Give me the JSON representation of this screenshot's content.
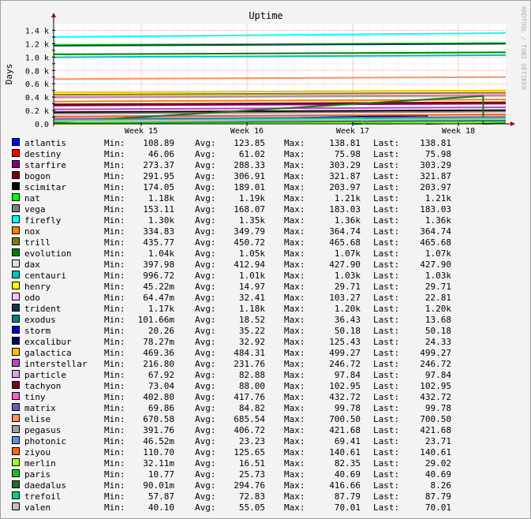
{
  "chart_data": {
    "type": "line",
    "title": "Uptime",
    "ylabel": "Days",
    "watermark": "RRDTOOL / TOBI OETIKER",
    "x_ticks": [
      "Week 15",
      "Week 16",
      "Week 17",
      "Week 18"
    ],
    "y_ticks": [
      "0.0",
      "0.2 k",
      "0.4 k",
      "0.6 k",
      "0.8 k",
      "1.0 k",
      "1.2 k",
      "1.4 k"
    ],
    "ylim": [
      0,
      1500
    ],
    "grid": true,
    "legend_placement": "bottom",
    "stat_labels": {
      "min": "Min:",
      "avg": "Avg:",
      "max": "Max:",
      "last": "Last:"
    },
    "series": [
      {
        "name": "atlantis",
        "color": "#0000ff",
        "min": "108.89",
        "avg": "123.85",
        "max": "138.81",
        "last": "138.81"
      },
      {
        "name": "destiny",
        "color": "#ff0000",
        "min": "46.06",
        "avg": "61.02",
        "max": "75.98",
        "last": "75.98"
      },
      {
        "name": "starfire",
        "color": "#800080",
        "min": "273.37",
        "avg": "288.33",
        "max": "303.29",
        "last": "303.29"
      },
      {
        "name": "bogon",
        "color": "#800000",
        "min": "291.95",
        "avg": "306.91",
        "max": "321.87",
        "last": "321.87"
      },
      {
        "name": "scimitar",
        "color": "#000000",
        "min": "174.05",
        "avg": "189.01",
        "max": "203.97",
        "last": "203.97"
      },
      {
        "name": "nat",
        "color": "#00ff00",
        "min": "1.18k",
        "avg": "1.19k",
        "max": "1.21k",
        "last": "1.21k"
      },
      {
        "name": "vega",
        "color": "#808080",
        "min": "153.11",
        "avg": "168.07",
        "max": "183.03",
        "last": "183.03"
      },
      {
        "name": "firefly",
        "color": "#00ffff",
        "min": "1.30k",
        "avg": "1.35k",
        "max": "1.36k",
        "last": "1.36k"
      },
      {
        "name": "nox",
        "color": "#ff8000",
        "min": "334.83",
        "avg": "349.79",
        "max": "364.74",
        "last": "364.74"
      },
      {
        "name": "trill",
        "color": "#808000",
        "min": "435.77",
        "avg": "450.72",
        "max": "465.68",
        "last": "465.68"
      },
      {
        "name": "evolution",
        "color": "#008000",
        "min": "1.04k",
        "avg": "1.05k",
        "max": "1.07k",
        "last": "1.07k"
      },
      {
        "name": "dax",
        "color": "#e0e0e0",
        "min": "397.98",
        "avg": "412.94",
        "max": "427.90",
        "last": "427.90"
      },
      {
        "name": "centauri",
        "color": "#00c0c0",
        "min": "996.72",
        "avg": "1.01k",
        "max": "1.03k",
        "last": "1.03k"
      },
      {
        "name": "henry",
        "color": "#ffff00",
        "min": "45.22m",
        "avg": "14.97",
        "max": "29.71",
        "last": "29.71"
      },
      {
        "name": "odo",
        "color": "#ffc0ff",
        "min": "64.47m",
        "avg": "32.41",
        "max": "103.27",
        "last": "22.81"
      },
      {
        "name": "trident",
        "color": "#004040",
        "min": "1.17k",
        "avg": "1.18k",
        "max": "1.20k",
        "last": "1.20k"
      },
      {
        "name": "exodus",
        "color": "#008080",
        "min": "101.66m",
        "avg": "18.52",
        "max": "36.43",
        "last": "13.68"
      },
      {
        "name": "storm",
        "color": "#0000c0",
        "min": "20.26",
        "avg": "35.22",
        "max": "50.18",
        "last": "50.18"
      },
      {
        "name": "excalibur",
        "color": "#000060",
        "min": "78.27m",
        "avg": "32.92",
        "max": "125.43",
        "last": "24.33"
      },
      {
        "name": "galactica",
        "color": "#ffc000",
        "min": "469.36",
        "avg": "484.31",
        "max": "499.27",
        "last": "499.27"
      },
      {
        "name": "interstellar",
        "color": "#c040c0",
        "min": "216.80",
        "avg": "231.76",
        "max": "246.72",
        "last": "246.72"
      },
      {
        "name": "particle",
        "color": "#e0a0e0",
        "min": "67.92",
        "avg": "82.88",
        "max": "97.84",
        "last": "97.84"
      },
      {
        "name": "tachyon",
        "color": "#800020",
        "min": "73.04",
        "avg": "88.00",
        "max": "102.95",
        "last": "102.95"
      },
      {
        "name": "tiny",
        "color": "#ff60c0",
        "min": "402.80",
        "avg": "417.76",
        "max": "432.72",
        "last": "432.72"
      },
      {
        "name": "matrix",
        "color": "#6060c0",
        "min": "69.86",
        "avg": "84.82",
        "max": "99.78",
        "last": "99.78"
      },
      {
        "name": "elise",
        "color": "#ff9060",
        "min": "670.58",
        "avg": "685.54",
        "max": "700.50",
        "last": "700.50"
      },
      {
        "name": "pegasus",
        "color": "#a0a0a0",
        "min": "391.76",
        "avg": "406.72",
        "max": "421.68",
        "last": "421.68"
      },
      {
        "name": "photonic",
        "color": "#6090e0",
        "min": "46.52m",
        "avg": "23.23",
        "max": "69.41",
        "last": "23.71"
      },
      {
        "name": "ziyou",
        "color": "#ff6020",
        "min": "110.70",
        "avg": "125.65",
        "max": "140.61",
        "last": "140.61"
      },
      {
        "name": "merlin",
        "color": "#a0ff20",
        "min": "32.11m",
        "avg": "16.51",
        "max": "82.35",
        "last": "29.02"
      },
      {
        "name": "paris",
        "color": "#20c020",
        "min": "10.77",
        "avg": "25.73",
        "max": "40.69",
        "last": "40.69"
      },
      {
        "name": "daedalus",
        "color": "#207020",
        "min": "90.01m",
        "avg": "294.76",
        "max": "416.66",
        "last": "8.26"
      },
      {
        "name": "trefoil",
        "color": "#00d080",
        "min": "57.87",
        "avg": "72.83",
        "max": "87.79",
        "last": "87.79"
      },
      {
        "name": "valen",
        "color": "#c0c0c0",
        "min": "40.10",
        "avg": "55.05",
        "max": "70.01",
        "last": "70.01"
      }
    ]
  }
}
